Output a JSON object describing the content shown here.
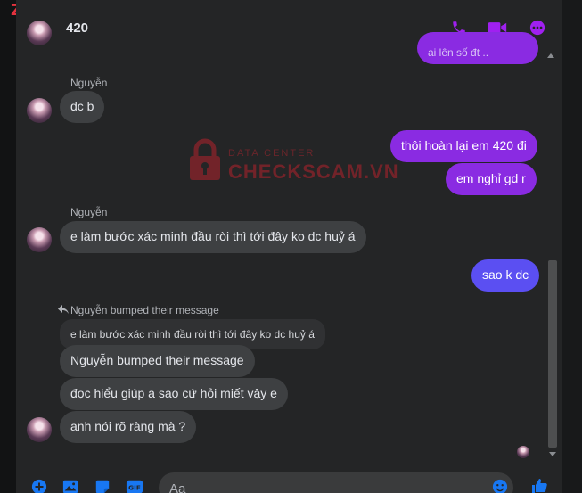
{
  "header": {
    "title": "420",
    "icons": [
      "phone-icon",
      "video-camera-icon",
      "more-options-icon"
    ]
  },
  "colors": {
    "accent": "#8a2be2",
    "accent_blue": "#5b4ff2",
    "incoming_bubble": "#3e4042",
    "background": "#242526"
  },
  "watermark": {
    "line1": "DATA CENTER",
    "line2": "CHECKSCAM.VN"
  },
  "messages": {
    "top_partial": "ai lên số đt ..",
    "sender1": "Nguyễn",
    "m1": "dc b",
    "o1": "thôi hoàn lại em 420 đi",
    "o2": "em nghỉ gd r",
    "sender2": "Nguyễn",
    "m2": "e làm bước xác minh đầu ròi thì tới đây ko dc huỷ á",
    "o3": "sao k dc",
    "bumped_note": "Nguyễn bumped their message",
    "quoted": "e làm bước xác minh đầu ròi thì tới đây ko dc huỷ á",
    "bumped_bubble": "Nguyễn bumped their message",
    "m3": "đọc hiểu giúp a sao cứ hỏi miết vậy e",
    "m4": "anh nói rõ ràng mà ?"
  },
  "composer": {
    "placeholder": "Aa",
    "icons": [
      "plus-icon",
      "image-icon",
      "sticker-icon",
      "gif-icon",
      "emoji-icon",
      "like-icon"
    ]
  }
}
